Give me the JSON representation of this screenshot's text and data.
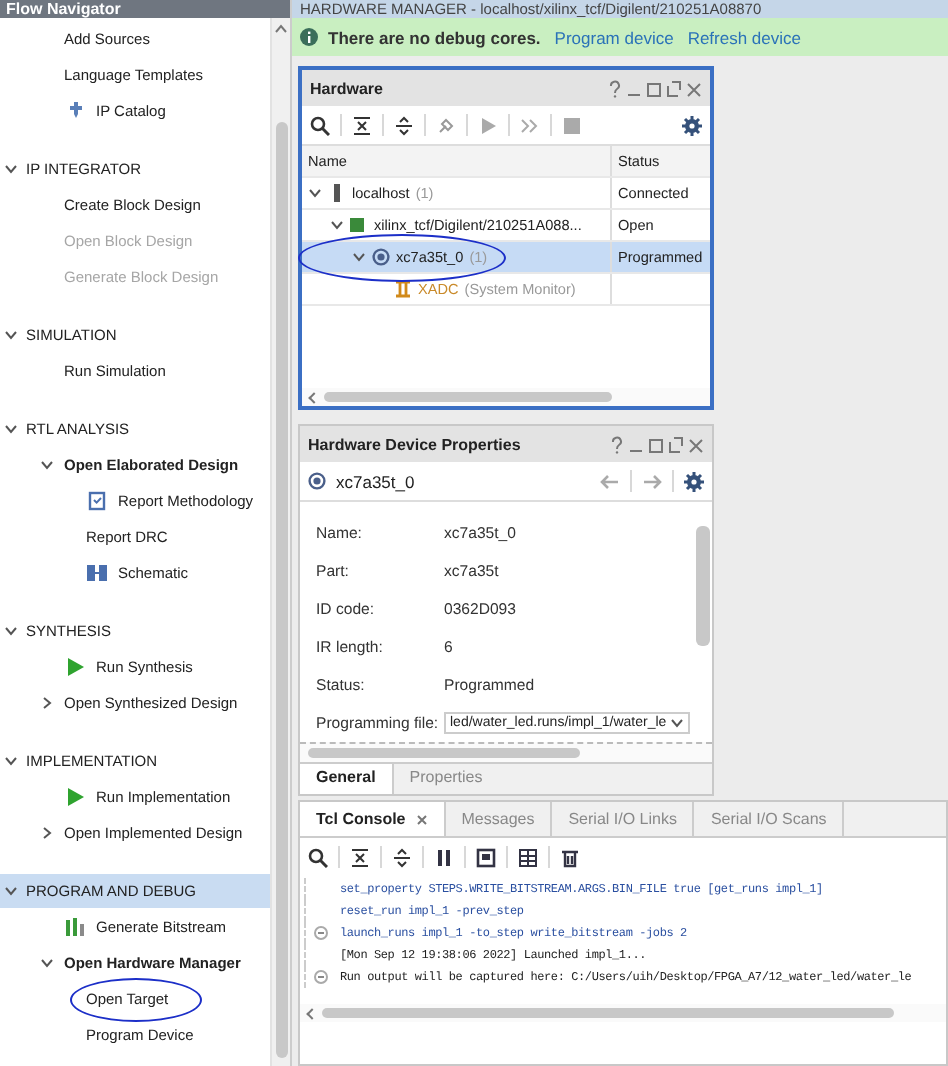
{
  "sidebar": {
    "title": "Flow Navigator",
    "sections": [
      {
        "items": [
          {
            "label": "Add Sources"
          },
          {
            "label": "Language Templates"
          },
          {
            "label": "IP Catalog",
            "kind": "ip"
          }
        ]
      },
      {
        "title": "IP INTEGRATOR",
        "expanded": true,
        "selected": false,
        "items": [
          {
            "label": "Create Block Design"
          },
          {
            "label": "Open Block Design",
            "disabled": true
          },
          {
            "label": "Generate Block Design",
            "disabled": true
          }
        ]
      },
      {
        "title": "SIMULATION",
        "expanded": true,
        "selected": false,
        "items": [
          {
            "label": "Run Simulation"
          }
        ]
      },
      {
        "title": "RTL ANALYSIS",
        "expanded": true,
        "selected": false,
        "items": [
          {
            "label": "Open Elaborated Design",
            "expanded": true,
            "children": [
              {
                "label": "Report Methodology",
                "kind": "report"
              },
              {
                "label": "Report DRC"
              },
              {
                "label": "Schematic",
                "kind": "schematic"
              }
            ]
          }
        ]
      },
      {
        "title": "SYNTHESIS",
        "expanded": true,
        "selected": false,
        "items": [
          {
            "label": "Run Synthesis",
            "kind": "run"
          },
          {
            "label": "Open Synthesized Design",
            "expanded": false
          }
        ]
      },
      {
        "title": "IMPLEMENTATION",
        "expanded": true,
        "selected": false,
        "items": [
          {
            "label": "Run Implementation",
            "kind": "run"
          },
          {
            "label": "Open Implemented Design",
            "expanded": false
          }
        ]
      },
      {
        "title": "PROGRAM AND DEBUG",
        "expanded": true,
        "selected": true,
        "items": [
          {
            "label": "Generate Bitstream",
            "kind": "bitstream"
          },
          {
            "label": "Open Hardware Manager",
            "expanded": true,
            "children": [
              {
                "label": "Open Target",
                "circled": true
              },
              {
                "label": "Program Device"
              }
            ]
          }
        ]
      }
    ]
  },
  "header": {
    "title": "HARDWARE MANAGER - localhost/xilinx_tcf/Digilent/210251A08870"
  },
  "info_bar": {
    "message": "There are no debug cores.",
    "links": [
      "Program device",
      "Refresh device"
    ]
  },
  "hardware": {
    "title": "Hardware",
    "columns": [
      "Name",
      "Status"
    ],
    "rows": [
      {
        "kind": "host",
        "name": "localhost",
        "count": "(1)",
        "status": "Connected",
        "expanded": true,
        "selected": false,
        "children": [
          {
            "kind": "target",
            "name": "xilinx_tcf/Digilent/210251A088...",
            "status": "Open",
            "expanded": true,
            "selected": false,
            "children": [
              {
                "kind": "device",
                "name": "xc7a35t_0",
                "count": "(1)",
                "status": "Programmed",
                "expanded": true,
                "selected": true,
                "circled": true,
                "children": [
                  {
                    "kind": "monitor",
                    "name": "XADC",
                    "count": "(System Monitor)",
                    "selected": false
                  }
                ]
              }
            ]
          }
        ]
      }
    ]
  },
  "properties": {
    "title": "Hardware Device Properties",
    "device": "xc7a35t_0",
    "fields": [
      {
        "label": "Name:",
        "value": "xc7a35t_0"
      },
      {
        "label": "Part:",
        "value": "xc7a35t"
      },
      {
        "label": "ID code:",
        "value": "0362D093"
      },
      {
        "label": "IR length:",
        "value": "6"
      },
      {
        "label": "Status:",
        "value": "Programmed"
      },
      {
        "label": "Programming file:",
        "value": "led/water_led.runs/impl_1/water_le",
        "kind": "dropdown"
      }
    ],
    "tabs": [
      {
        "label": "General",
        "selected": true
      },
      {
        "label": "Properties",
        "selected": false
      }
    ]
  },
  "console": {
    "tabs": [
      {
        "label": "Tcl Console",
        "selected": true,
        "closable": true
      },
      {
        "label": "Messages",
        "selected": false
      },
      {
        "label": "Serial I/O Links",
        "selected": false
      },
      {
        "label": "Serial I/O Scans",
        "selected": false
      }
    ],
    "lines": [
      {
        "kind": "command",
        "text": "set_property STEPS.WRITE_BITSTREAM.ARGS.BIN_FILE true [get_runs impl_1]"
      },
      {
        "kind": "command",
        "text": "reset_run impl_1 -prev_step"
      },
      {
        "kind": "command",
        "text": "launch_runs impl_1 -to_step write_bitstream -jobs 2",
        "fold": true
      },
      {
        "kind": "output",
        "text": "[Mon Sep 12 19:38:06 2022] Launched impl_1..."
      },
      {
        "kind": "output",
        "text": "Run output will be captured here: C:/Users/uih/Desktop/FPGA_A7/12_water_led/water_le",
        "fold": true
      }
    ]
  }
}
